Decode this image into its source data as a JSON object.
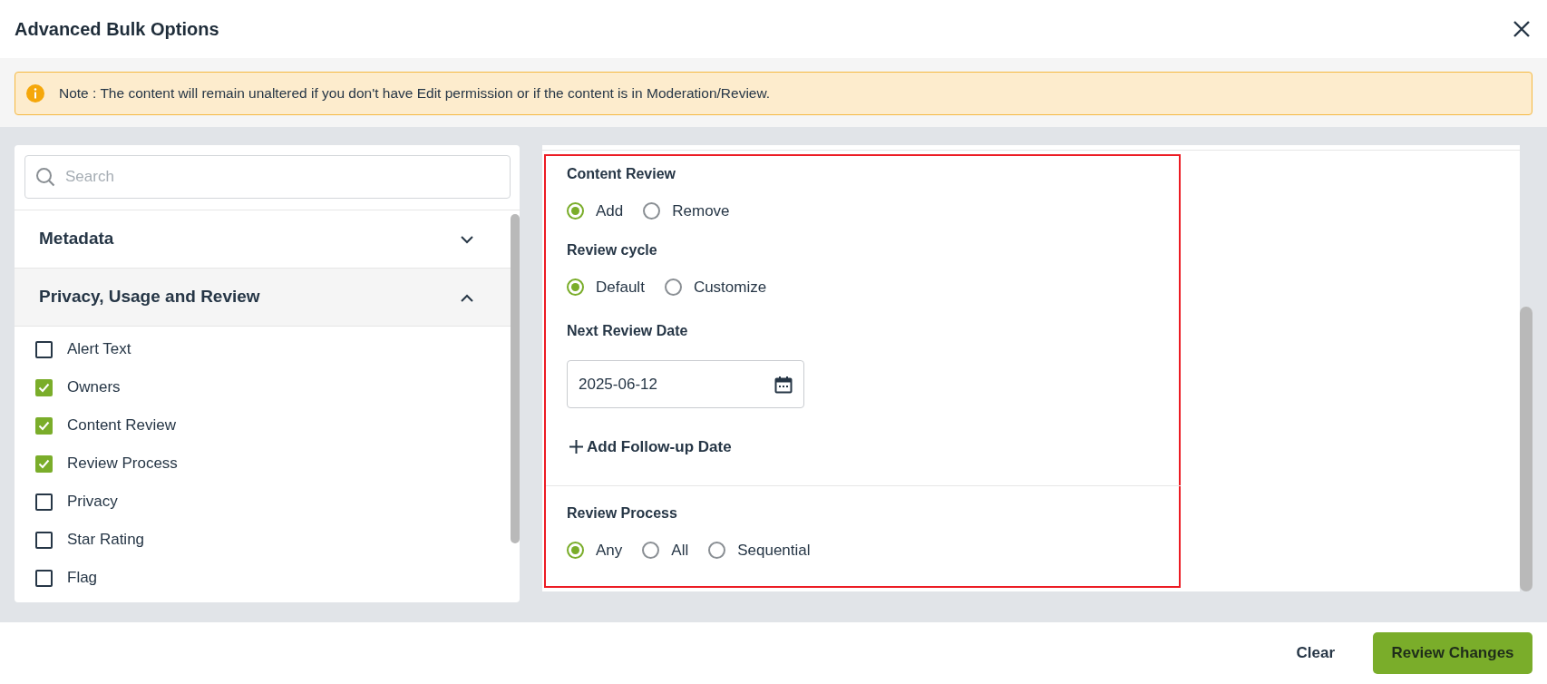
{
  "dialog": {
    "title": "Advanced Bulk Options"
  },
  "note": {
    "text": "Note : The content will remain unaltered if you don't have Edit permission or if the content is in Moderation/Review."
  },
  "search": {
    "placeholder": "Search"
  },
  "sections": [
    {
      "title": "Metadata",
      "expanded": false
    },
    {
      "title": "Privacy, Usage and Review",
      "expanded": true,
      "options": [
        {
          "label": "Alert Text",
          "checked": false
        },
        {
          "label": "Owners",
          "checked": true
        },
        {
          "label": "Content Review",
          "checked": true
        },
        {
          "label": "Review Process",
          "checked": true
        },
        {
          "label": "Privacy",
          "checked": false
        },
        {
          "label": "Star Rating",
          "checked": false
        },
        {
          "label": "Flag",
          "checked": false
        }
      ]
    }
  ],
  "form_blocks": [
    {
      "groups": [
        {
          "kind": "radio",
          "title": "Content Review",
          "options": [
            {
              "label": "Add",
              "selected": true
            },
            {
              "label": "Remove",
              "selected": false
            }
          ]
        },
        {
          "kind": "radio",
          "title": "Review cycle",
          "options": [
            {
              "label": "Default",
              "selected": true
            },
            {
              "label": "Customize",
              "selected": false
            }
          ]
        },
        {
          "kind": "date",
          "title": "Next Review Date",
          "value": "2025-06-12"
        },
        {
          "kind": "link",
          "label": "Add Follow-up Date"
        }
      ]
    },
    {
      "groups": [
        {
          "kind": "radio",
          "title": "Review Process",
          "options": [
            {
              "label": "Any",
              "selected": true
            },
            {
              "label": "All",
              "selected": false
            },
            {
              "label": "Sequential",
              "selected": false
            }
          ]
        }
      ]
    }
  ],
  "footer": {
    "buttons": [
      {
        "kind": "plain",
        "label": "Clear"
      },
      {
        "kind": "primary",
        "label": "Review Changes"
      }
    ]
  }
}
